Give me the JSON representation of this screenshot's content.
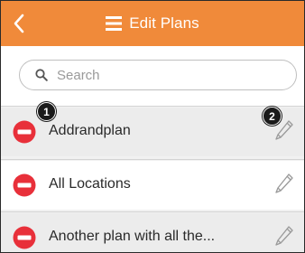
{
  "header": {
    "title": "Edit Plans",
    "back_icon": "chevron-left-icon",
    "title_icon": "list-icon",
    "background_color": "#f08a3a",
    "text_color": "#ffffff"
  },
  "search": {
    "placeholder": "Search",
    "value": "",
    "icon": "search-icon"
  },
  "plans": [
    {
      "label": "Addrandplan"
    },
    {
      "label": "All Locations"
    },
    {
      "label": "Another plan with all the..."
    }
  ],
  "row_icons": {
    "delete": "delete-icon",
    "delete_color": "#e8303a",
    "edit": "pencil-icon"
  },
  "callouts": [
    "1",
    "2"
  ]
}
